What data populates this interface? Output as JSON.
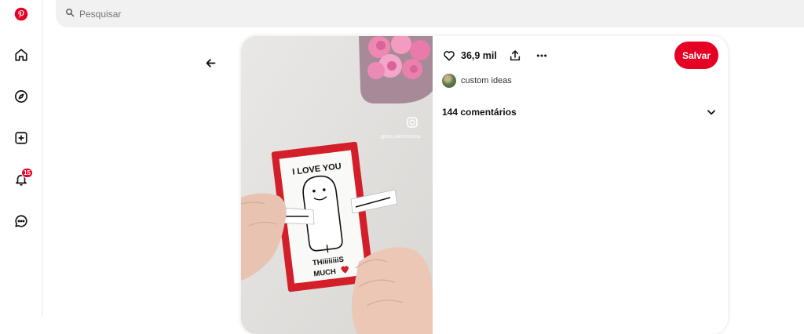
{
  "app": {
    "brand_color": "#e60023"
  },
  "sidebar": {
    "items": [
      {
        "icon": "pinterest-logo-icon"
      },
      {
        "icon": "home-icon"
      },
      {
        "icon": "explore-compass-icon"
      },
      {
        "icon": "create-plus-icon"
      },
      {
        "icon": "notifications-bell-icon",
        "badge": "15"
      },
      {
        "icon": "messages-chat-icon"
      }
    ]
  },
  "search": {
    "placeholder": "Pesquisar",
    "value": ""
  },
  "pin": {
    "image": {
      "card_text_top": "I LOVE YOU",
      "card_text_bottom1": "THiiiiiiiiS",
      "card_text_bottom2": "MUCH",
      "watermark": "@BELLARTEDUIOS"
    },
    "likes": "36,9 mil",
    "save_label": "Salvar",
    "creator": "custom ideas",
    "comments_label": "144 comentários"
  }
}
